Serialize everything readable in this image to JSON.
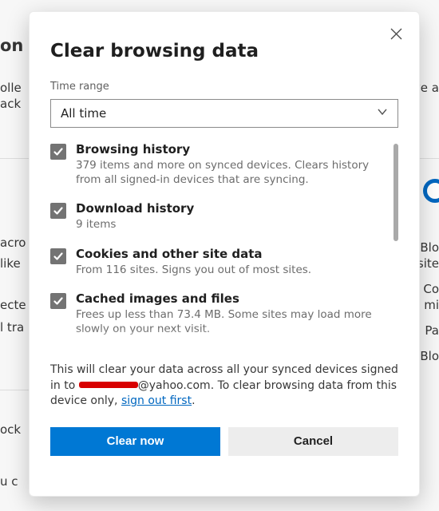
{
  "dialog": {
    "title": "Clear browsing data",
    "time_range_label": "Time range",
    "time_range_value": "All time",
    "items": [
      {
        "title": "Browsing history",
        "sub": "379 items and more on synced devices. Clears history from all signed-in devices that are syncing.",
        "checked": true
      },
      {
        "title": "Download history",
        "sub": "9 items",
        "checked": true
      },
      {
        "title": "Cookies and other site data",
        "sub": "From 116 sites. Signs you out of most sites.",
        "checked": true
      },
      {
        "title": "Cached images and files",
        "sub": "Frees up less than 73.4 MB. Some sites may load more slowly on your next visit.",
        "checked": true
      }
    ],
    "notice_pre": "This will clear your data across all your synced devices signed in to ",
    "notice_email_suffix": "@yahoo.com",
    "notice_mid": ". To clear browsing data from this device only, ",
    "notice_link": "sign out first",
    "notice_post": ".",
    "clear_label": "Clear now",
    "cancel_label": "Cancel"
  },
  "background": {
    "left_frag1": "on",
    "left_frag2": "olle",
    "left_frag3": "ack",
    "left_frag4": "acro",
    "left_frag5": "like",
    "left_frag6": "ecte",
    "left_frag7": "l tra",
    "left_frag8": "ock",
    "left_frag9": "u c",
    "right_frag1": "ove a",
    "right_frag2": "Blo",
    "right_frag3": "site",
    "right_frag4": "Co",
    "right_frag5": "mi",
    "right_frag6": "Pa",
    "right_frag7": "Blo"
  }
}
